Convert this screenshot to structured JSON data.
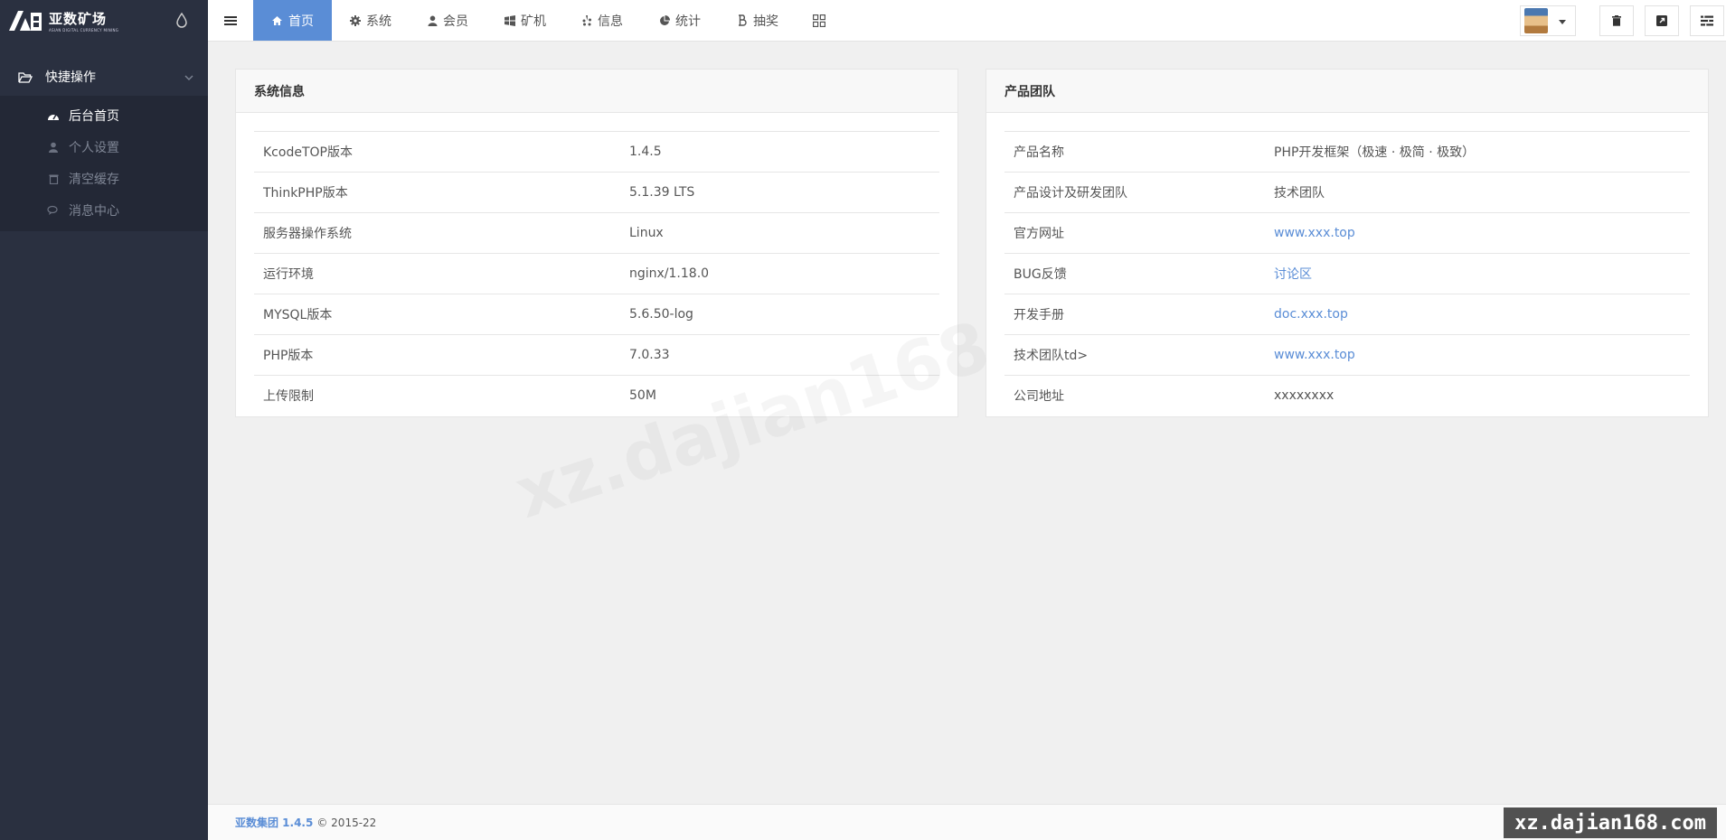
{
  "brand": {
    "logo_text": "亚数矿场",
    "logo_subtext": "ASIAN DIGITAL CURRENCY MINING"
  },
  "sidebar": {
    "group_label": "快捷操作",
    "items": [
      {
        "label": "后台首页",
        "icon": "dashboard-icon",
        "active": true
      },
      {
        "label": "个人设置",
        "icon": "user-icon",
        "active": false
      },
      {
        "label": "清空缓存",
        "icon": "trash-icon",
        "active": false
      },
      {
        "label": "消息中心",
        "icon": "chat-icon",
        "active": false
      }
    ]
  },
  "topnav": {
    "tabs": [
      {
        "label": "首页",
        "icon": "home-icon",
        "active": true
      },
      {
        "label": "系统",
        "icon": "gear-icon",
        "active": false
      },
      {
        "label": "会员",
        "icon": "user-icon",
        "active": false
      },
      {
        "label": "矿机",
        "icon": "windows-icon",
        "active": false
      },
      {
        "label": "信息",
        "icon": "yelp-icon",
        "active": false
      },
      {
        "label": "统计",
        "icon": "pie-chart-icon",
        "active": false
      },
      {
        "label": "抽奖",
        "icon": "bitcoin-icon",
        "active": false
      }
    ]
  },
  "system_panel": {
    "title": "系统信息",
    "rows": [
      {
        "key": "KcodeTOP版本",
        "value": "1.4.5"
      },
      {
        "key": "ThinkPHP版本",
        "value": "5.1.39 LTS"
      },
      {
        "key": "服务器操作系统",
        "value": "Linux"
      },
      {
        "key": "运行环境",
        "value": "nginx/1.18.0"
      },
      {
        "key": "MYSQL版本",
        "value": "5.6.50-log"
      },
      {
        "key": "PHP版本",
        "value": "7.0.33"
      },
      {
        "key": "上传限制",
        "value": "50M"
      }
    ]
  },
  "team_panel": {
    "title": "产品团队",
    "rows": [
      {
        "key": "产品名称",
        "value": "PHP开发框架（极速 · 极简 · 极致）",
        "link": false
      },
      {
        "key": "产品设计及研发团队",
        "value": "技术团队",
        "link": false
      },
      {
        "key": "官方网址",
        "value": "www.xxx.top",
        "link": true
      },
      {
        "key": "BUG反馈",
        "value": "讨论区",
        "link": true
      },
      {
        "key": "开发手册",
        "value": "doc.xxx.top",
        "link": true
      },
      {
        "key": "技术团队td>",
        "value": "www.xxx.top",
        "link": true
      },
      {
        "key": "公司地址",
        "value": "xxxxxxxx",
        "link": false
      }
    ]
  },
  "footer": {
    "brand": "亚数集团 1.4.5",
    "copyright": "© 2015-22"
  },
  "watermark": {
    "center": "xz.dajian168",
    "corner": "xz.dajian168.com"
  },
  "colors": {
    "accent": "#5a8dd6",
    "sidebar_bg": "#2a3040"
  }
}
